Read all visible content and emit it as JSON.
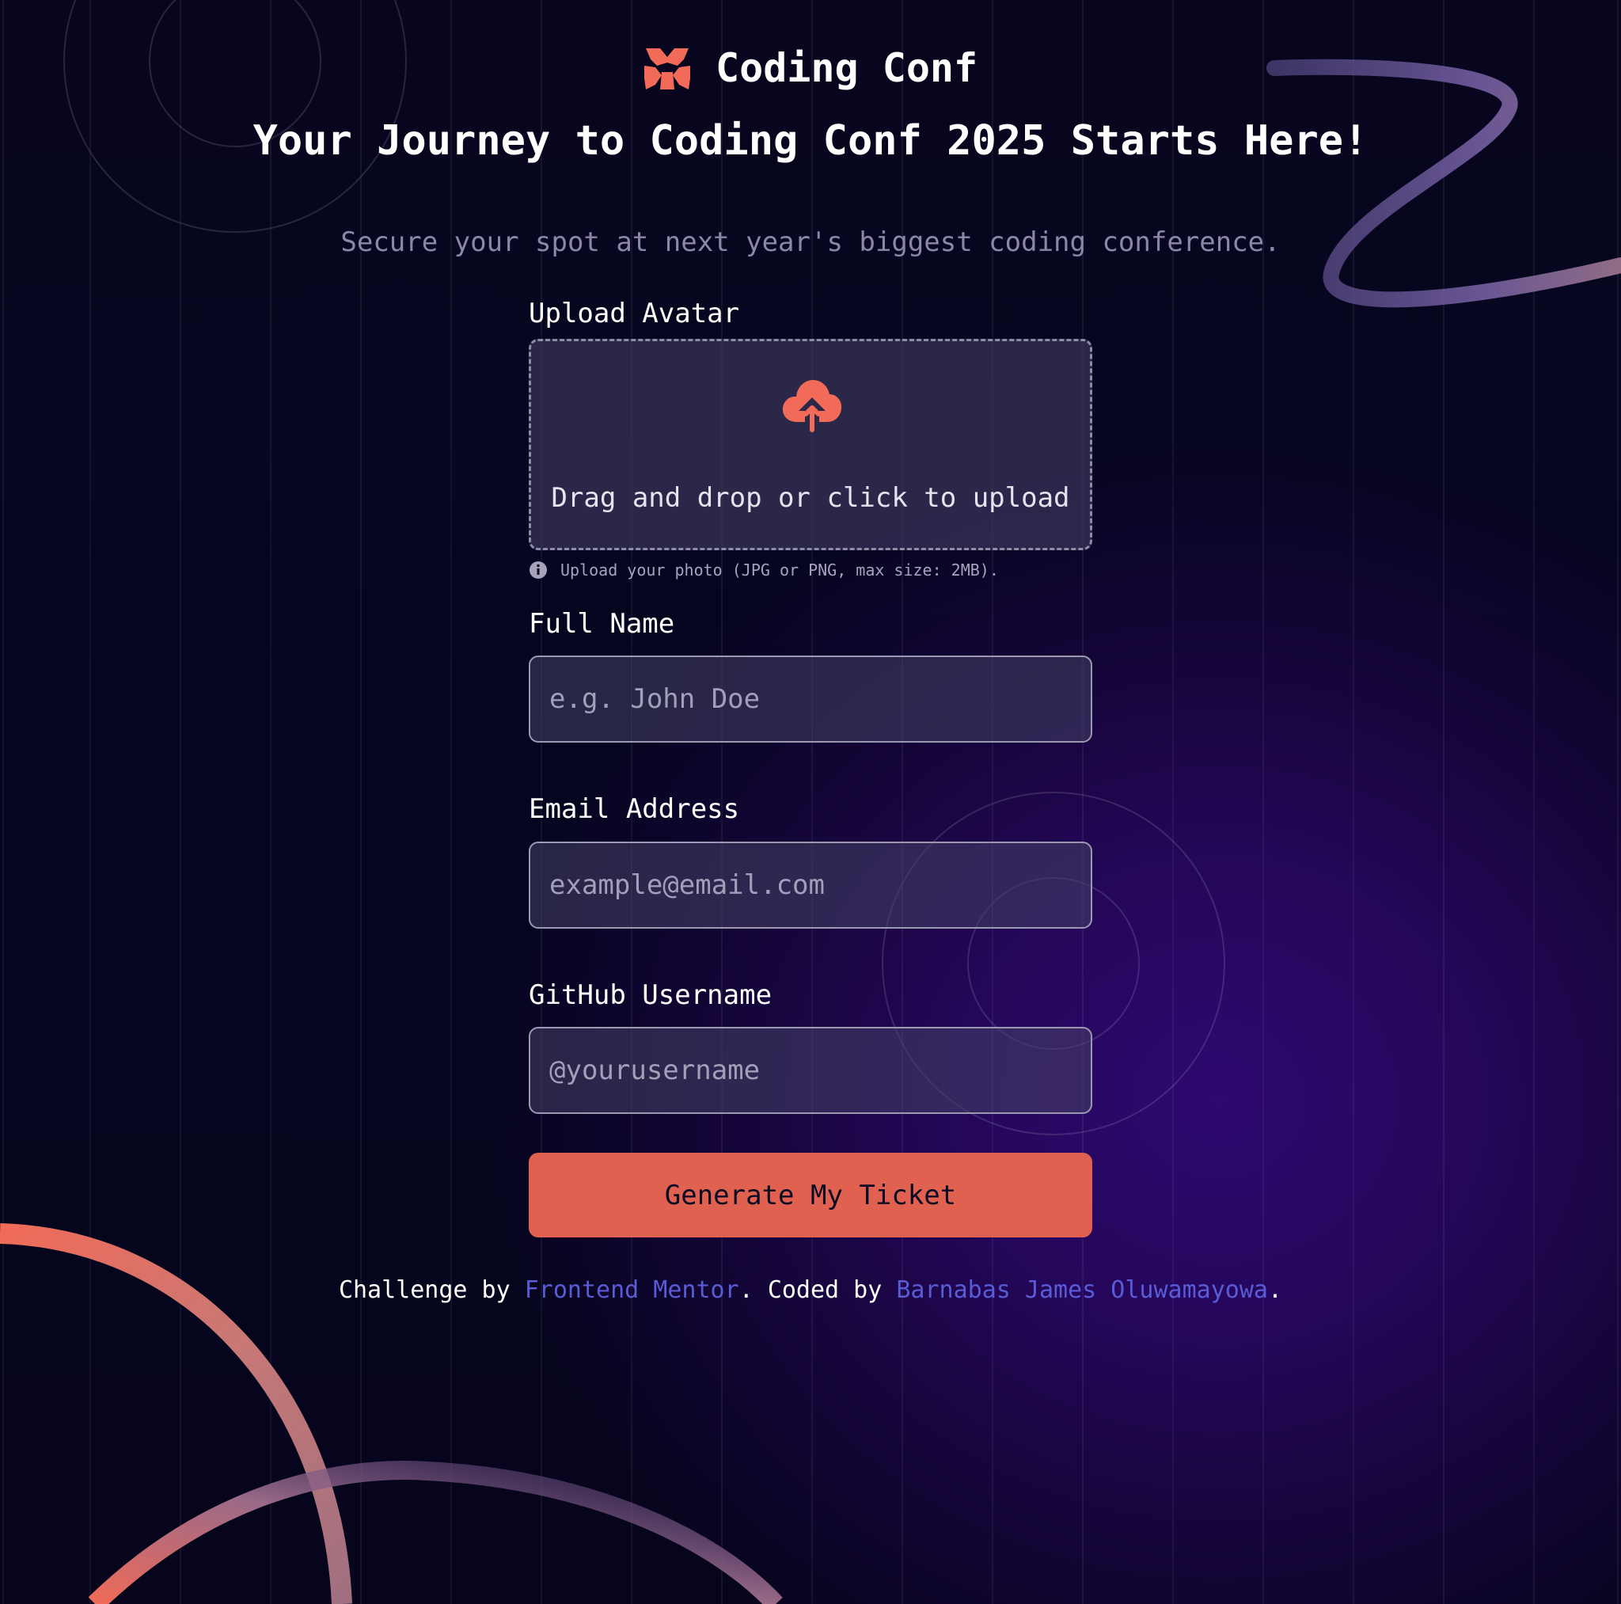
{
  "colors": {
    "accent": "#e16150",
    "link": "#5a5bd6",
    "muted_text": "#8c86a8",
    "field_border": "#9b98b2"
  },
  "header": {
    "logo_icon": "coding-conf-logo-icon",
    "logo_text": "Coding Conf",
    "title": "Your Journey to Coding Conf 2025 Starts Here!",
    "subtitle": "Secure your spot at next year's biggest coding conference."
  },
  "form": {
    "avatar": {
      "label": "Upload Avatar",
      "icon": "upload-cloud-icon",
      "dropzone_text": "Drag and drop or click to upload",
      "hint_icon": "info-icon",
      "hint": "Upload your photo (JPG or PNG, max size: 2MB)."
    },
    "full_name": {
      "label": "Full Name",
      "value": "",
      "placeholder": "e.g. John Doe"
    },
    "email": {
      "label": "Email Address",
      "value": "",
      "placeholder": "example@email.com"
    },
    "github": {
      "label": "GitHub Username",
      "value": "",
      "placeholder": "@yourusername"
    },
    "submit_label": "Generate My Ticket"
  },
  "footer": {
    "challenge_by": "Challenge by",
    "frontend_mentor": "Frontend Mentor",
    "separator": ".",
    "coded_by": "Coded by",
    "author": "Barnabas James Oluwamayowa",
    "end": "."
  }
}
